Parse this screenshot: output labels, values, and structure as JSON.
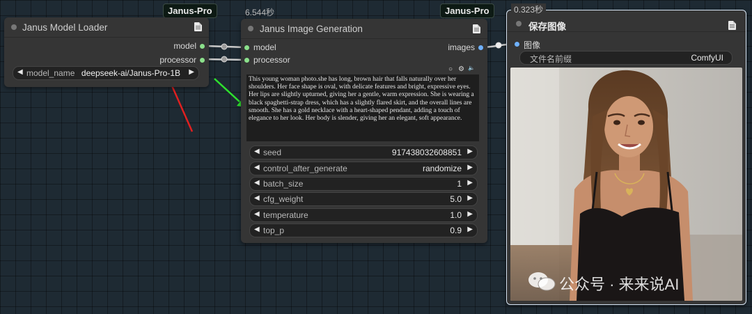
{
  "colors": {
    "canvas_bg": "#1e2a33",
    "node_bg": "#353535",
    "port_green": "#8be08b",
    "port_blue": "#6fb1ff",
    "arrow_red": "#e02020",
    "arrow_green": "#2ee02e"
  },
  "loader": {
    "badge": "Janus-Pro",
    "title": "Janus Model Loader",
    "outputs": [
      "model",
      "processor"
    ],
    "widget_label": "model_name",
    "widget_value": "deepseek-ai/Janus-Pro-1B"
  },
  "generator": {
    "badge": "Janus-Pro",
    "timing": "6.544秒",
    "title": "Janus Image Generation",
    "inputs": [
      "model",
      "processor"
    ],
    "output": "images",
    "prompt": "This young woman photo.she has long, brown hair that falls naturally over her shoulders. Her face shape is oval, with delicate features and bright, expressive eyes. Her lips are slightly upturned, giving her a gentle, warm expression. She is wearing a black spaghetti-strap dress, which has a slightly flared skirt, and the overall lines are smooth. She has a gold necklace with a heart-shaped pendant, adding a touch of elegance to her look. Her body is slender, giving her an elegant, soft appearance.",
    "widgets": [
      {
        "label": "seed",
        "value": "917438032608851"
      },
      {
        "label": "control_after_generate",
        "value": "randomize"
      },
      {
        "label": "batch_size",
        "value": "1"
      },
      {
        "label": "cfg_weight",
        "value": "5.0"
      },
      {
        "label": "temperature",
        "value": "1.0"
      },
      {
        "label": "top_p",
        "value": "0.9"
      }
    ]
  },
  "saver": {
    "timing": "0.323秒",
    "title": "保存图像",
    "input": "图像",
    "widget_label": "文件名前缀",
    "widget_value": "ComfyUI"
  },
  "watermark": "公众号 · 来来说AI",
  "icons": {
    "doc": "document-icon",
    "arrow_left": "◀",
    "arrow_right": "▶",
    "circle": "○",
    "gear": "⚙",
    "speaker": "🔈"
  }
}
